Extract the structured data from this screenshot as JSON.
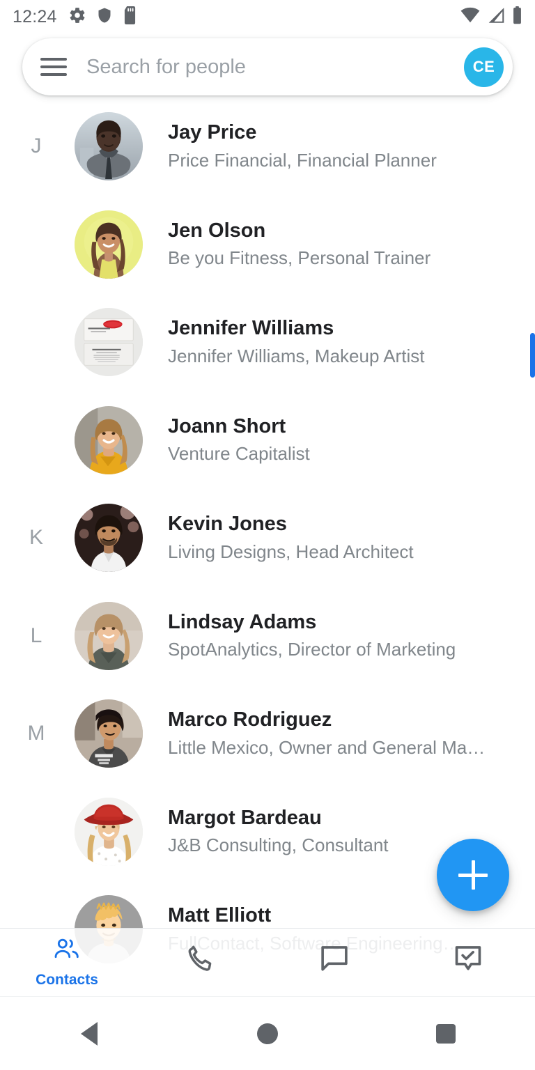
{
  "status_bar": {
    "time": "12:24",
    "left_icons": [
      "gear-icon",
      "shield-icon",
      "sd-card-icon"
    ],
    "right_icons": [
      "wifi-icon",
      "cellular-signal-icon",
      "battery-icon"
    ]
  },
  "search": {
    "menu_icon": "hamburger-menu-icon",
    "placeholder": "Search for people",
    "value": "",
    "avatar_initials": "CE",
    "avatar_color": "#29b6e8"
  },
  "contacts": [
    {
      "section": "J",
      "name": "Jay Price",
      "title": "Price Financial, Financial Planner",
      "avatar": "photo-man-suit"
    },
    {
      "section": "",
      "name": "Jen Olson",
      "title": "Be you Fitness, Personal Trainer",
      "avatar": "photo-woman-yellow"
    },
    {
      "section": "",
      "name": "Jennifer Williams",
      "title": "Jennifer Williams, Makeup Artist",
      "avatar": "photo-business-card"
    },
    {
      "section": "",
      "name": "Joann Short",
      "title": "Venture Capitalist",
      "avatar": "photo-woman-yellow-top"
    },
    {
      "section": "K",
      "name": "Kevin Jones",
      "title": "Living Designs, Head Architect",
      "avatar": "photo-man-dark"
    },
    {
      "section": "L",
      "name": "Lindsay Adams",
      "title": "SpotAnalytics, Director of Marketing",
      "avatar": "photo-woman-grey-top"
    },
    {
      "section": "M",
      "name": "Marco Rodriguez",
      "title": "Little Mexico, Owner and General Ma…",
      "avatar": "photo-man-tshirt"
    },
    {
      "section": "",
      "name": "Margot Bardeau",
      "title": "J&B Consulting, Consultant",
      "avatar": "photo-woman-red-hat"
    },
    {
      "section": "",
      "name": "Matt Elliott",
      "title": "FullContact, Software Engineering…",
      "avatar": "photo-man-cartoon"
    }
  ],
  "fab": {
    "icon": "plus-icon",
    "color": "#2196f3"
  },
  "scrollbar": {
    "color": "#1a73e8"
  },
  "bottom_tabs": [
    {
      "label": "Contacts",
      "icon": "people-icon",
      "active": true
    },
    {
      "label": "",
      "icon": "phone-icon",
      "active": false
    },
    {
      "label": "",
      "icon": "chat-bubble-icon",
      "active": false
    },
    {
      "label": "",
      "icon": "task-check-icon",
      "active": false
    }
  ],
  "android_nav": [
    {
      "label": "",
      "icon": "back-triangle-icon"
    },
    {
      "label": "",
      "icon": "home-circle-icon"
    },
    {
      "label": "",
      "icon": "recents-square-icon"
    }
  ]
}
